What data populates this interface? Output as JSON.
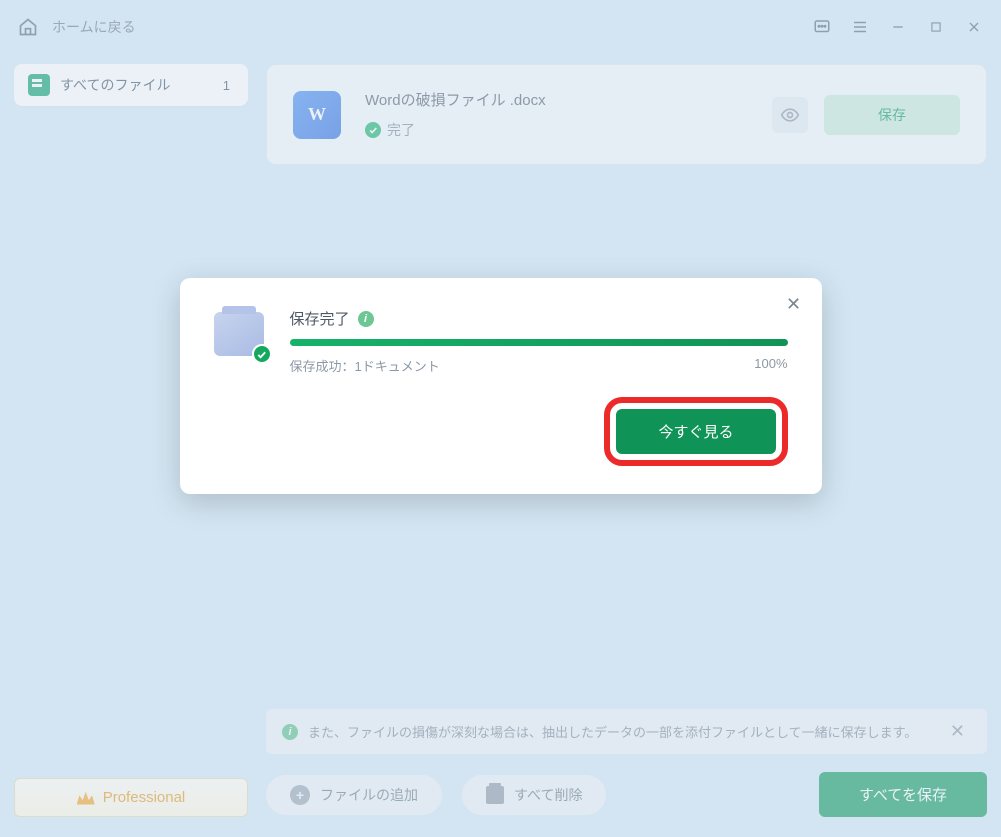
{
  "titlebar": {
    "home_label": "ホームに戻る"
  },
  "sidebar": {
    "items": [
      {
        "label": "すべてのファイル",
        "count": "1"
      }
    ],
    "pro_label": "Professional"
  },
  "file_card": {
    "filename": "Wordの破損ファイル .docx",
    "status": "完了",
    "save_label": "保存"
  },
  "info_bar": {
    "text": "また、ファイルの損傷が深刻な場合は、抽出したデータの一部を添付ファイルとして一緒に保存します。"
  },
  "bottom": {
    "add_label": "ファイルの追加",
    "delete_label": "すべて削除",
    "save_all_label": "すべてを保存"
  },
  "dialog": {
    "title": "保存完了",
    "sub": "保存成功：1ドキュメント",
    "percent": "100%",
    "view_now": "今すぐ見る"
  }
}
